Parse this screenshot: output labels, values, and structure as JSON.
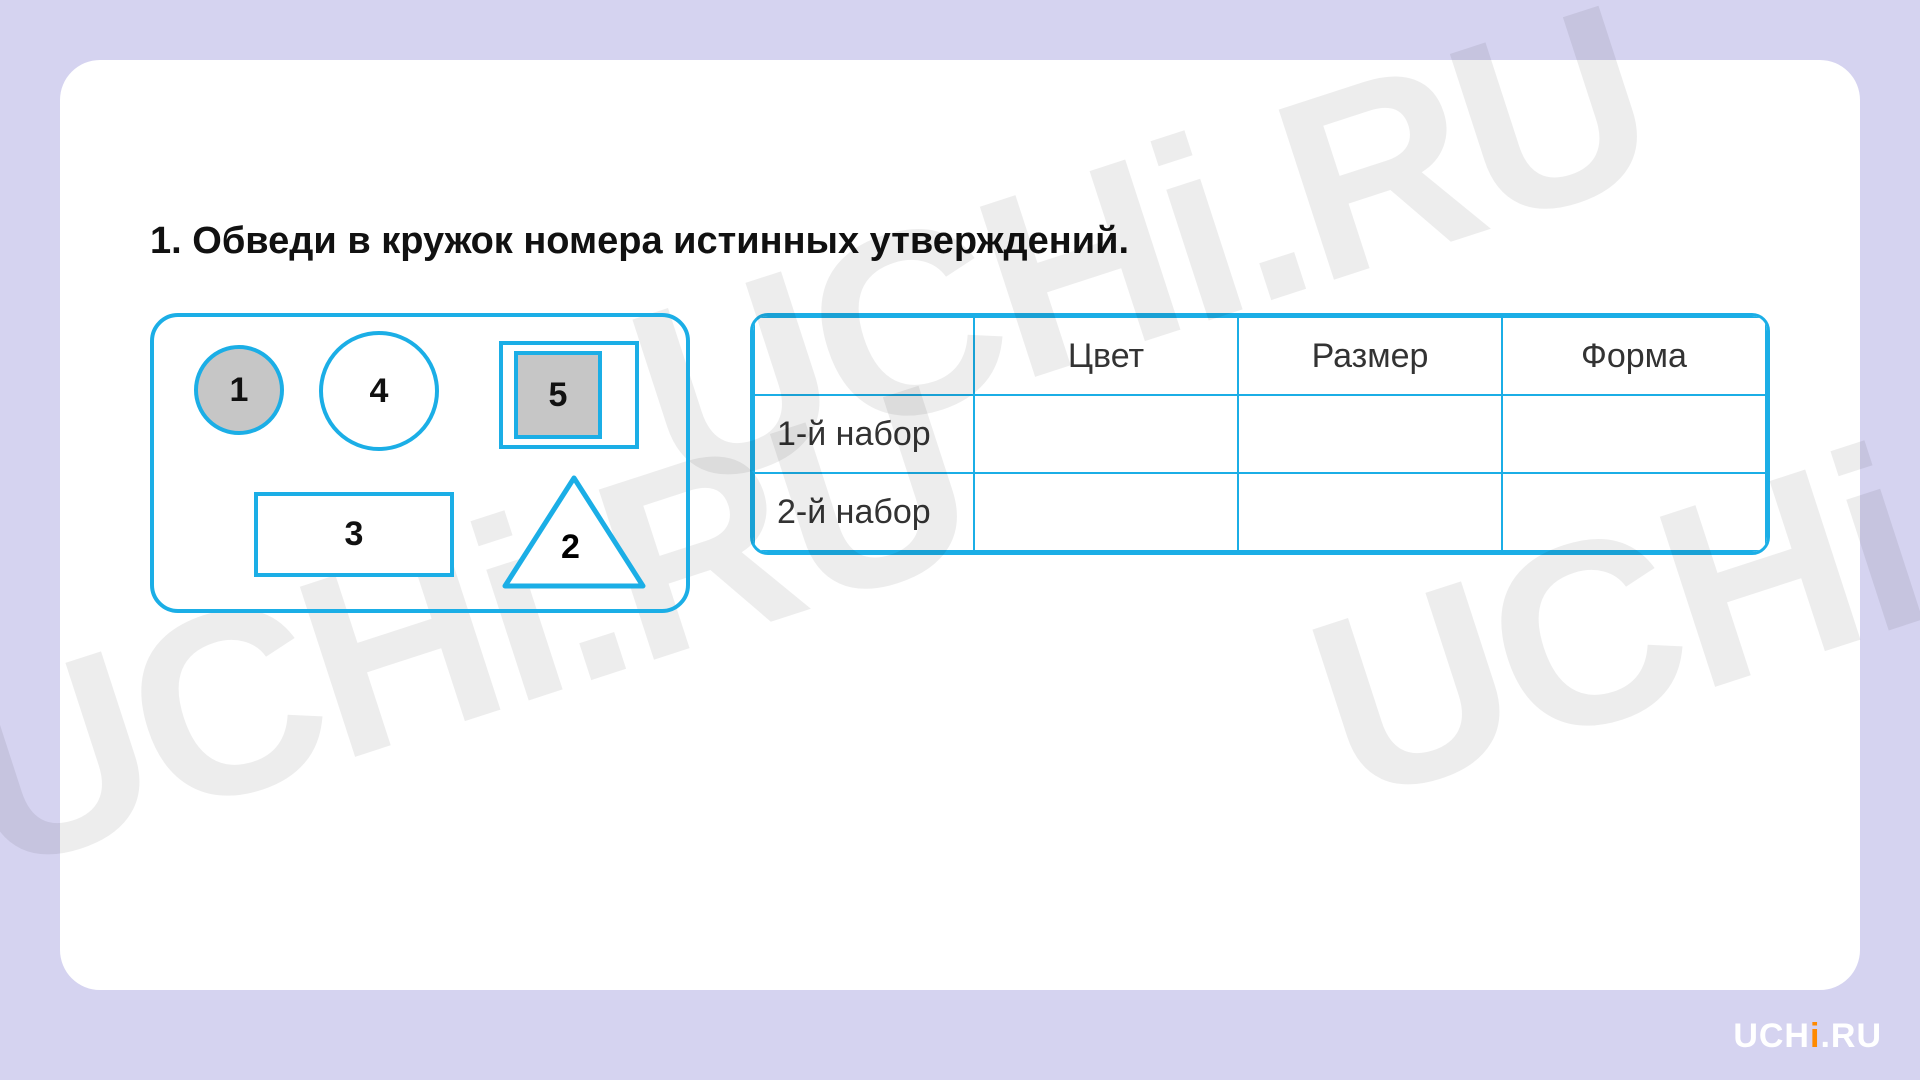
{
  "question": {
    "number": "1.",
    "text": "Обведи в кружок номера истинных утверждений."
  },
  "shapes": {
    "circle1": "1",
    "circle4": "4",
    "square5": "5",
    "rect3": "3",
    "triangle2": "2"
  },
  "table": {
    "headers": [
      "Цвет",
      "Размер",
      "Форма"
    ],
    "rows": [
      {
        "label": "1-й набор",
        "cells": [
          "",
          "",
          ""
        ]
      },
      {
        "label": "2-й набор",
        "cells": [
          "",
          "",
          ""
        ]
      }
    ]
  },
  "watermark": "UCHi.RU",
  "brand": {
    "pre": "UCH",
    "i": "i",
    "post": ".RU"
  },
  "colors": {
    "accent": "#1baee6",
    "bg": "#d5d3f0",
    "fill": "#c6c6c6"
  }
}
